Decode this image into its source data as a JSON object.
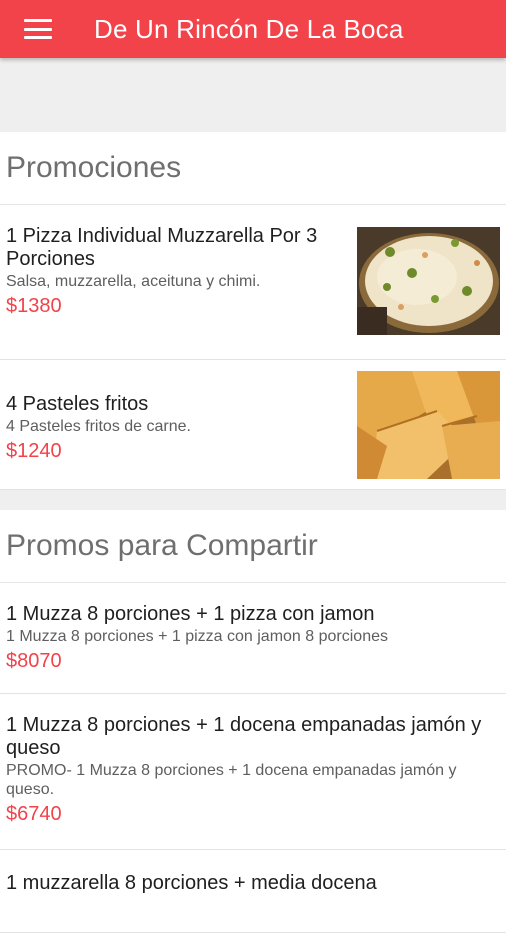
{
  "appbar": {
    "title": "De Un Rincón De La Boca",
    "menu_icon": "hamburger-menu-icon",
    "color": "#f2424a"
  },
  "sections": [
    {
      "title": "Promociones",
      "items": [
        {
          "name": "1 Pizza Individual Muzzarella Por 3 Porciones",
          "description": "Salsa, muzzarella, aceituna y chimi.",
          "price": "$1380",
          "image": "pizza-image"
        },
        {
          "name": "4 Pasteles fritos",
          "description": "4 Pasteles fritos de carne.",
          "price": "$1240",
          "image": "fried-pastries-image"
        }
      ]
    },
    {
      "title": "Promos para Compartir",
      "items": [
        {
          "name": "1 Muzza 8 porciones + 1 pizza con jamon",
          "description": "1 Muzza 8 porciones + 1 pizza con jamon 8 porciones",
          "price": "$8070"
        },
        {
          "name": "1 Muzza 8 porciones + 1 docena empanadas jamón y queso",
          "description": "PROMO- 1 Muzza 8 porciones + 1 docena empanadas jamón y queso.",
          "price": "$6740"
        },
        {
          "name": "1 muzzarella 8 porciones + media docena",
          "description": "",
          "price": ""
        }
      ]
    }
  ]
}
